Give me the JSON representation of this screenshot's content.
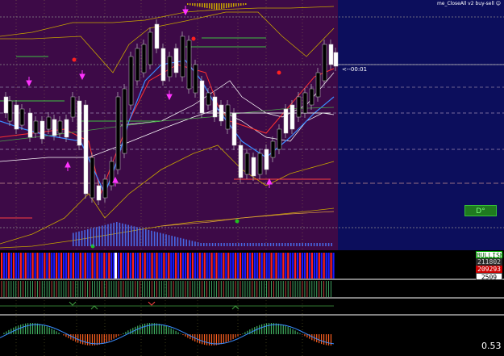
{
  "header": {
    "indicator_title": "me_CloseAll v2 buy-sell ☺"
  },
  "countdown": {
    "text": "<--00:01"
  },
  "signal_button": {
    "label": "D°"
  },
  "strength_panel": {
    "bullish_label": "BULLISH",
    "value_1": "211802",
    "value_2": "209293",
    "value_3": "2509"
  },
  "oscillator_readout": {
    "value": "0.53"
  },
  "colors": {
    "chart_background": "#3d0a47",
    "right_area": "#0c0e5c",
    "bull_candle": "#ffffff",
    "bear_candle": "#000000",
    "arrow_marker": "#ff33ff",
    "red_dot": "#ff2020",
    "green_dot": "#20c020"
  }
}
